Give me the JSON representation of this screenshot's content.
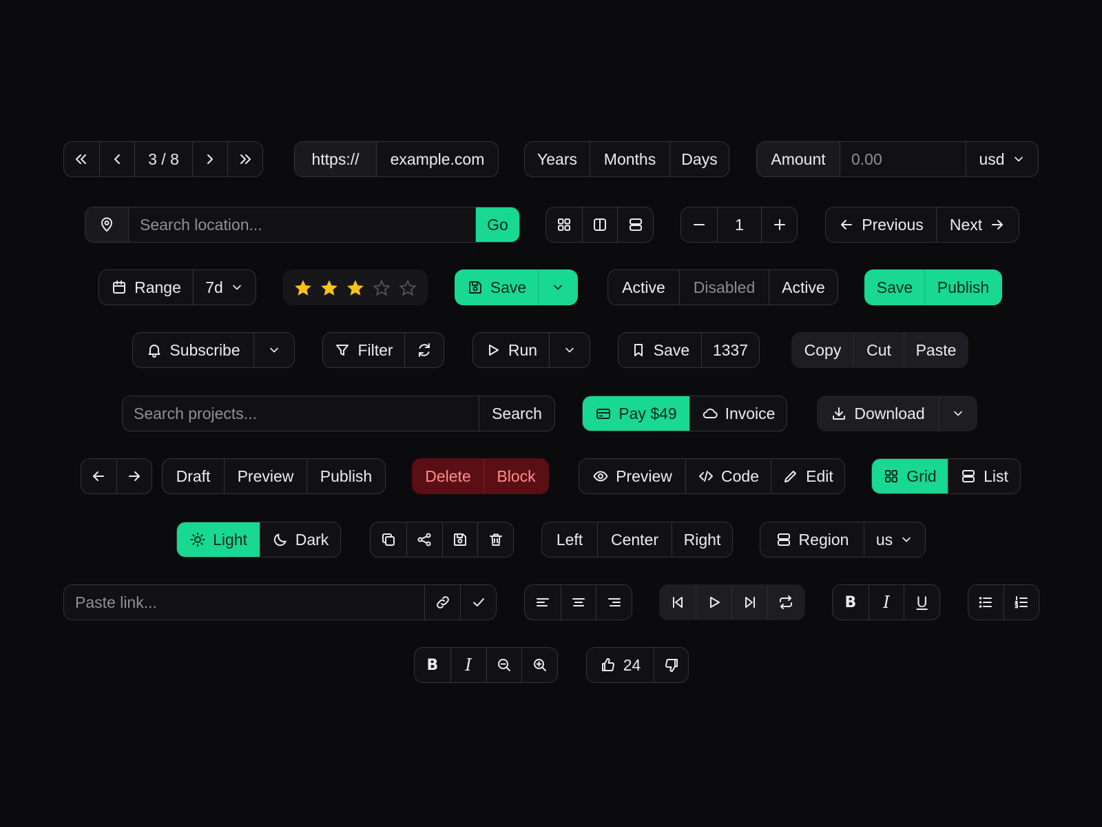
{
  "colors": {
    "background": "#0b0b0d",
    "accent": "#19d892",
    "danger": "#5a0f14",
    "star": "#f6c21b"
  },
  "pager": {
    "label": "3 / 8"
  },
  "url": {
    "prefix": "https://",
    "domain": "example.com"
  },
  "period": {
    "years": "Years",
    "months": "Months",
    "days": "Days"
  },
  "amount": {
    "label": "Amount",
    "placeholder": "0.00",
    "currency": "usd"
  },
  "location": {
    "placeholder": "Search location...",
    "go": "Go"
  },
  "stepper": {
    "value": "1"
  },
  "prevnext": {
    "prev": "Previous",
    "next": "Next"
  },
  "range": {
    "label": "Range",
    "value": "7d"
  },
  "rating": {
    "value": 3,
    "max": 5
  },
  "save_split": {
    "label": "Save"
  },
  "status": {
    "a": "Active",
    "b": "Disabled",
    "c": "Active"
  },
  "save_publish": {
    "save": "Save",
    "publish": "Publish"
  },
  "subscribe": {
    "label": "Subscribe"
  },
  "filter": {
    "label": "Filter"
  },
  "run": {
    "label": "Run"
  },
  "bookmark": {
    "label": "Save",
    "count": "1337"
  },
  "clipboard": {
    "copy": "Copy",
    "cut": "Cut",
    "paste": "Paste"
  },
  "projects": {
    "placeholder": "Search projects...",
    "button": "Search"
  },
  "pay": {
    "pay": "Pay $49",
    "invoice": "Invoice"
  },
  "download": {
    "label": "Download"
  },
  "workflow": {
    "draft": "Draft",
    "preview": "Preview",
    "publish": "Publish"
  },
  "danger": {
    "delete": "Delete",
    "block": "Block"
  },
  "view_mode": {
    "preview": "Preview",
    "code": "Code",
    "edit": "Edit"
  },
  "layout": {
    "grid": "Grid",
    "list": "List"
  },
  "theme": {
    "light": "Light",
    "dark": "Dark"
  },
  "align": {
    "left": "Left",
    "center": "Center",
    "right": "Right"
  },
  "region": {
    "label": "Region",
    "value": "us"
  },
  "link": {
    "placeholder": "Paste link..."
  },
  "format": {
    "bold": "B",
    "italic": "I",
    "underline": "U"
  },
  "format2": {
    "bold": "B",
    "italic": "I"
  },
  "votes": {
    "count": "24"
  }
}
